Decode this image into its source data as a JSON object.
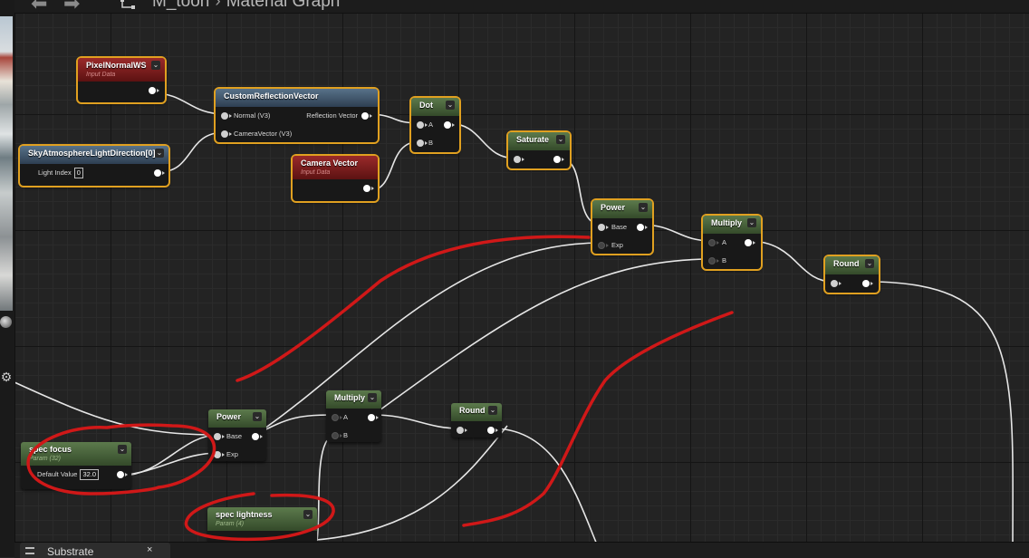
{
  "breadcrumb": {
    "asset": "M_toon",
    "separator": "›",
    "graph": "Material Graph"
  },
  "toolbar": {
    "back_icon": "back-arrow-icon",
    "forward_icon": "forward-arrow-icon"
  },
  "nodes": {
    "pixel_normal": {
      "title": "PixelNormalWS",
      "subtitle": "Input Data"
    },
    "sky_atmo": {
      "title": "SkyAtmosphereLightDirection[0]",
      "light_index_label": "Light Index",
      "light_index_value": "0"
    },
    "custom_refl": {
      "title": "CustomReflectionVector",
      "in1": "Normal (V3)",
      "in2": "CameraVector (V3)",
      "out": "Reflection Vector"
    },
    "camera_vec": {
      "title": "Camera Vector",
      "subtitle": "Input Data"
    },
    "dot": {
      "title": "Dot",
      "a": "A",
      "b": "B"
    },
    "saturate": {
      "title": "Saturate"
    },
    "power1": {
      "title": "Power",
      "base": "Base",
      "exp": "Exp"
    },
    "multiply1": {
      "title": "Multiply",
      "a": "A",
      "b": "B"
    },
    "round1": {
      "title": "Round"
    },
    "power2": {
      "title": "Power",
      "base": "Base",
      "exp": "Exp"
    },
    "multiply2": {
      "title": "Multiply",
      "a": "A",
      "b": "B"
    },
    "round2": {
      "title": "Round"
    },
    "spec_focus": {
      "title": "spec focus",
      "subtitle": "Param (32)",
      "default_label": "Default Value",
      "default_value": "32.0"
    },
    "spec_lightness": {
      "title": "spec lightness",
      "subtitle": "Param (4)"
    }
  },
  "bottom": {
    "tab_label": "Substrate",
    "close": "×"
  },
  "colors": {
    "selection": "#e0a020",
    "annotation": "#d01818",
    "wire": "#e8e8e8"
  }
}
